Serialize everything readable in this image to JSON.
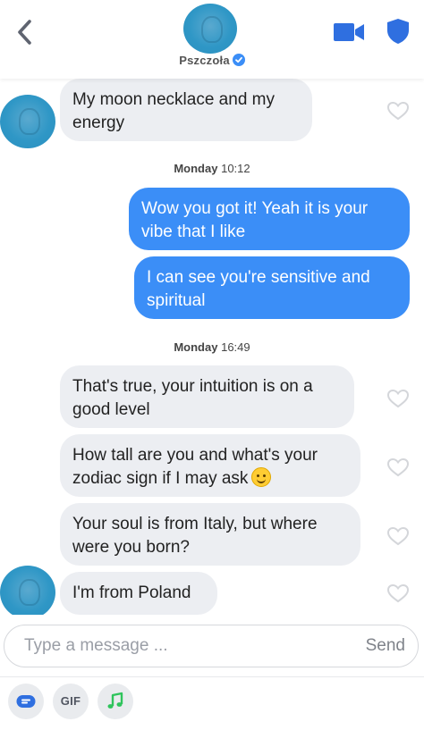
{
  "header": {
    "name": "Pszczoła"
  },
  "messages": [
    {
      "side": "in",
      "text": "My moon necklace and my energy"
    },
    {
      "side": "out",
      "text": "Wow you got it! Yeah it is your vibe that I like"
    },
    {
      "side": "out",
      "text": "I can see you're sensitive and spiritual"
    },
    {
      "side": "in",
      "text": "That's true, your intuition is on a good level"
    },
    {
      "side": "in",
      "text": "How tall are you and what's your zodiac sign if I may ask",
      "emoji": "slightly-smiling-face"
    },
    {
      "side": "in",
      "text": "Your soul is from Italy, but where were you born?"
    },
    {
      "side": "in",
      "text": "I'm from Poland"
    }
  ],
  "timestamps": [
    {
      "day": "Monday",
      "time": "10:12"
    },
    {
      "day": "Monday",
      "time": "16:49"
    }
  ],
  "composer": {
    "placeholder": "Type a message ...",
    "send_label": "Send",
    "gif_label": "GIF"
  },
  "icons": {
    "back": "chevron-left-icon",
    "video": "video-camera-icon",
    "safety": "shield-icon",
    "verified": "verified-badge-icon",
    "like": "heart-outline-icon",
    "stickers": "sticker-icon",
    "music": "music-note-icon"
  },
  "colors": {
    "accent_blue": "#3b8ef7",
    "incoming_bubble": "#eceef2",
    "outgoing_bubble": "#3b8ef7",
    "music_green": "#2fc45c"
  }
}
